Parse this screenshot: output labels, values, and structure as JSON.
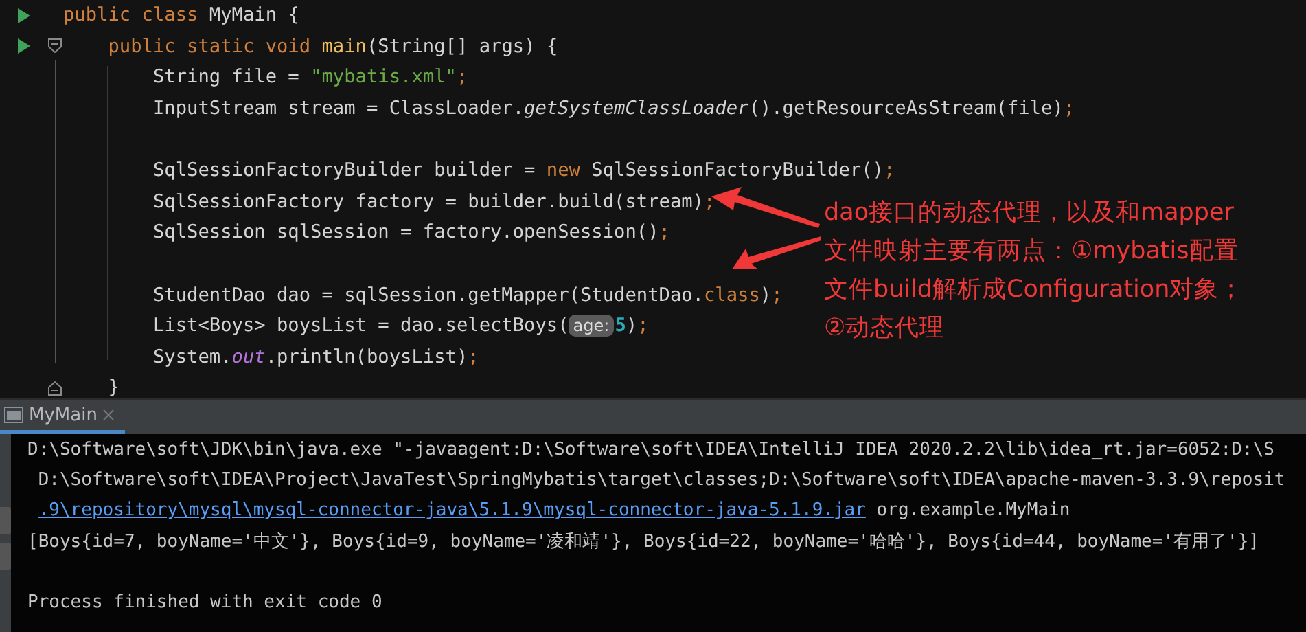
{
  "editor": {
    "lines": [
      {
        "kind": "code",
        "run": true,
        "tokens": [
          {
            "kind": "keyword",
            "text": "public class "
          },
          {
            "kind": "plain",
            "text": "MyMain {"
          }
        ]
      },
      {
        "kind": "fold-start",
        "run": true,
        "tokens": [
          {
            "kind": "keyword",
            "text": "    public static void "
          },
          {
            "kind": "method",
            "text": "main"
          },
          {
            "kind": "plain",
            "text": "(String[] args) {"
          }
        ]
      },
      {
        "kind": "code",
        "run": false,
        "tokens": [
          {
            "kind": "plain",
            "text": "        String file = "
          },
          {
            "kind": "string",
            "text": "\"mybatis.xml\""
          },
          {
            "kind": "keyword",
            "text": ";"
          }
        ]
      },
      {
        "kind": "code",
        "run": false,
        "tokens": [
          {
            "kind": "plain",
            "text": "        InputStream stream = ClassLoader."
          },
          {
            "kind": "static",
            "text": "getSystemClassLoader"
          },
          {
            "kind": "plain",
            "text": "().getResourceAsStream(file)"
          },
          {
            "kind": "keyword",
            "text": ";"
          }
        ]
      },
      {
        "kind": "blank",
        "run": false
      },
      {
        "kind": "code",
        "run": false,
        "tokens": [
          {
            "kind": "plain",
            "text": "        SqlSessionFactoryBuilder builder = "
          },
          {
            "kind": "keyword",
            "text": "new "
          },
          {
            "kind": "plain",
            "text": "SqlSessionFactoryBuilder()"
          },
          {
            "kind": "keyword",
            "text": ";"
          }
        ]
      },
      {
        "kind": "code",
        "run": false,
        "tokens": [
          {
            "kind": "plain",
            "text": "        SqlSessionFactory factory = builder.build(stream)"
          },
          {
            "kind": "keyword",
            "text": ";"
          }
        ]
      },
      {
        "kind": "code",
        "run": false,
        "tokens": [
          {
            "kind": "plain",
            "text": "        SqlSession sqlSession = factory.openSession()"
          },
          {
            "kind": "keyword",
            "text": ";"
          }
        ]
      },
      {
        "kind": "blank",
        "run": false
      },
      {
        "kind": "code",
        "run": false,
        "tokens": [
          {
            "kind": "plain",
            "text": "        StudentDao dao = sqlSession.getMapper(StudentDao."
          },
          {
            "kind": "keyword",
            "text": "class"
          },
          {
            "kind": "plain",
            "text": ")"
          },
          {
            "kind": "keyword",
            "text": ";"
          }
        ]
      },
      {
        "kind": "code",
        "run": false,
        "tokens": [
          {
            "kind": "plain",
            "text": "        List<Boys> boysList = dao.selectBoys("
          },
          {
            "kind": "hint",
            "text": "age:"
          },
          {
            "kind": "number",
            "text": "5"
          },
          {
            "kind": "plain",
            "text": ")"
          },
          {
            "kind": "keyword",
            "text": ";"
          }
        ]
      },
      {
        "kind": "code",
        "run": false,
        "tokens": [
          {
            "kind": "plain",
            "text": "        System."
          },
          {
            "kind": "field",
            "text": "out"
          },
          {
            "kind": "plain",
            "text": ".println(boysList)"
          },
          {
            "kind": "keyword",
            "text": ";"
          }
        ]
      },
      {
        "kind": "fold-end",
        "run": false,
        "tokens": [
          {
            "kind": "plain",
            "text": "    }"
          }
        ]
      }
    ]
  },
  "annotation": {
    "lines": [
      "dao接口的动态代理，以及和mapper",
      "文件映射主要有两点：①mybatis配置",
      "文件build解析成Configuration对象；",
      "②动态代理"
    ]
  },
  "tool_window": {
    "tabs": [
      {
        "label": "MyMain",
        "selected": true
      }
    ]
  },
  "console": {
    "lines": [
      {
        "kind": "output",
        "segments": [
          {
            "kind": "text",
            "text": "D:\\Software\\soft\\JDK\\bin\\java.exe \"-javaagent:D:\\Software\\soft\\IDEA\\IntelliJ IDEA 2020.2.2\\lib\\idea_rt.jar=6052:D:\\S"
          }
        ]
      },
      {
        "kind": "output",
        "segments": [
          {
            "kind": "text",
            "text": " D:\\Software\\soft\\IDEA\\Project\\JavaTest\\SpringMybatis\\target\\classes;D:\\Software\\soft\\IDEA\\apache-maven-3.3.9\\reposit"
          }
        ]
      },
      {
        "kind": "output",
        "segments": [
          {
            "kind": "link",
            "text": ".9\\repository\\mysql\\mysql-connector-java\\5.1.9\\mysql-connector-java-5.1.9.jar"
          },
          {
            "kind": "text",
            "text": " org.example.MyMain"
          }
        ]
      },
      {
        "kind": "output",
        "segments": [
          {
            "kind": "text",
            "text": "[Boys{id=7, boyName='中文'}, Boys{id=9, boyName='凌和靖'}, Boys{id=22, boyName='哈哈'}, Boys{id=44, boyName='有用了'}]"
          }
        ]
      },
      {
        "kind": "exit",
        "segments": [
          {
            "kind": "text",
            "text": "Process finished with exit code 0"
          }
        ]
      }
    ]
  }
}
